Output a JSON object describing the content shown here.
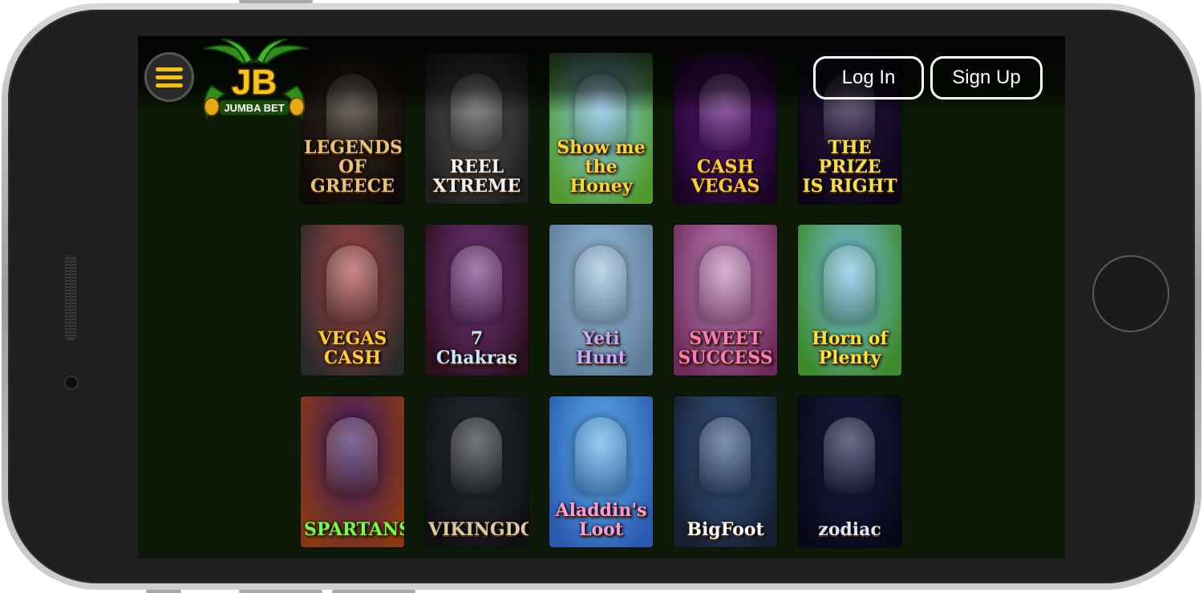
{
  "header": {
    "logo_text": "JB",
    "logo_subtext": "JUMBA BET",
    "login_label": "Log In",
    "signup_label": "Sign Up"
  },
  "colors": {
    "accent": "#f2c20f",
    "screen_bg": "#0c1a07",
    "button_border": "#ffffff"
  },
  "games": [
    {
      "title": "LEGENDS\nOF GREECE",
      "icon": "statue-art",
      "bg": "#3a2e22",
      "bg2": "#0e0a07",
      "fg": "#e8c27a"
    },
    {
      "title": "REEL\nXTREME",
      "icon": "motocross-art",
      "bg": "#5c5c5c",
      "bg2": "#1d1d1d",
      "fg": "#f0f0f0"
    },
    {
      "title": "Show me the\nHoney",
      "icon": "bees-art",
      "bg": "#8fd1ff",
      "bg2": "#4f9a2a",
      "fg": "#ffd23a"
    },
    {
      "title": "CASH\nVEGAS",
      "icon": "bell-art",
      "bg": "#6a1a8a",
      "bg2": "#1a0526",
      "fg": "#ffcc33"
    },
    {
      "title": "THE PRIZE\nIS RIGHT",
      "icon": "host-art",
      "bg": "#2d1a4a",
      "bg2": "#0d0418",
      "fg": "#f5e04a"
    },
    {
      "title": "VEGAS CASH",
      "icon": "racer-girl-art",
      "bg": "#b04a4a",
      "bg2": "#2a2a2a",
      "fg": "#ffcc33"
    },
    {
      "title": "7\nChakras",
      "icon": "chakra-art",
      "bg": "#7a3a8a",
      "bg2": "#2a0f1c",
      "fg": "#c9e6ff"
    },
    {
      "title": "Yeti\nHunt",
      "icon": "yeti-art",
      "bg": "#9fc4e0",
      "bg2": "#5b7a96",
      "fg": "#c9a6ff"
    },
    {
      "title": "SWEET\nSUCCESS",
      "icon": "candy-art",
      "bg": "#c78ac0",
      "bg2": "#6d2a5a",
      "fg": "#ff7ab8"
    },
    {
      "title": "Horn of\nPlenty",
      "icon": "horn-art",
      "bg": "#7cc4f0",
      "bg2": "#3c8a2a",
      "fg": "#ffdf3a"
    },
    {
      "title": "SPARTANS",
      "icon": "alien-art",
      "bg": "#3a1a6a",
      "bg2": "#8a3a10",
      "fg": "#6dff4a"
    },
    {
      "title": "VIKINGDOM",
      "icon": "viking-art",
      "bg": "#2b2f36",
      "bg2": "#0e1014",
      "fg": "#d9c9a0"
    },
    {
      "title": "Aladdin's Loot",
      "icon": "genie-art",
      "bg": "#5fb5f0",
      "bg2": "#2a5ab0",
      "fg": "#ff9ad5"
    },
    {
      "title": "BigFoot",
      "icon": "pixel-art",
      "bg": "#3a5a8a",
      "bg2": "#141f30",
      "fg": "#ffffff"
    },
    {
      "title": "zodiac",
      "icon": "zodiac-art",
      "bg": "#1d1f4a",
      "bg2": "#070818",
      "fg": "#d9e6ff"
    }
  ]
}
